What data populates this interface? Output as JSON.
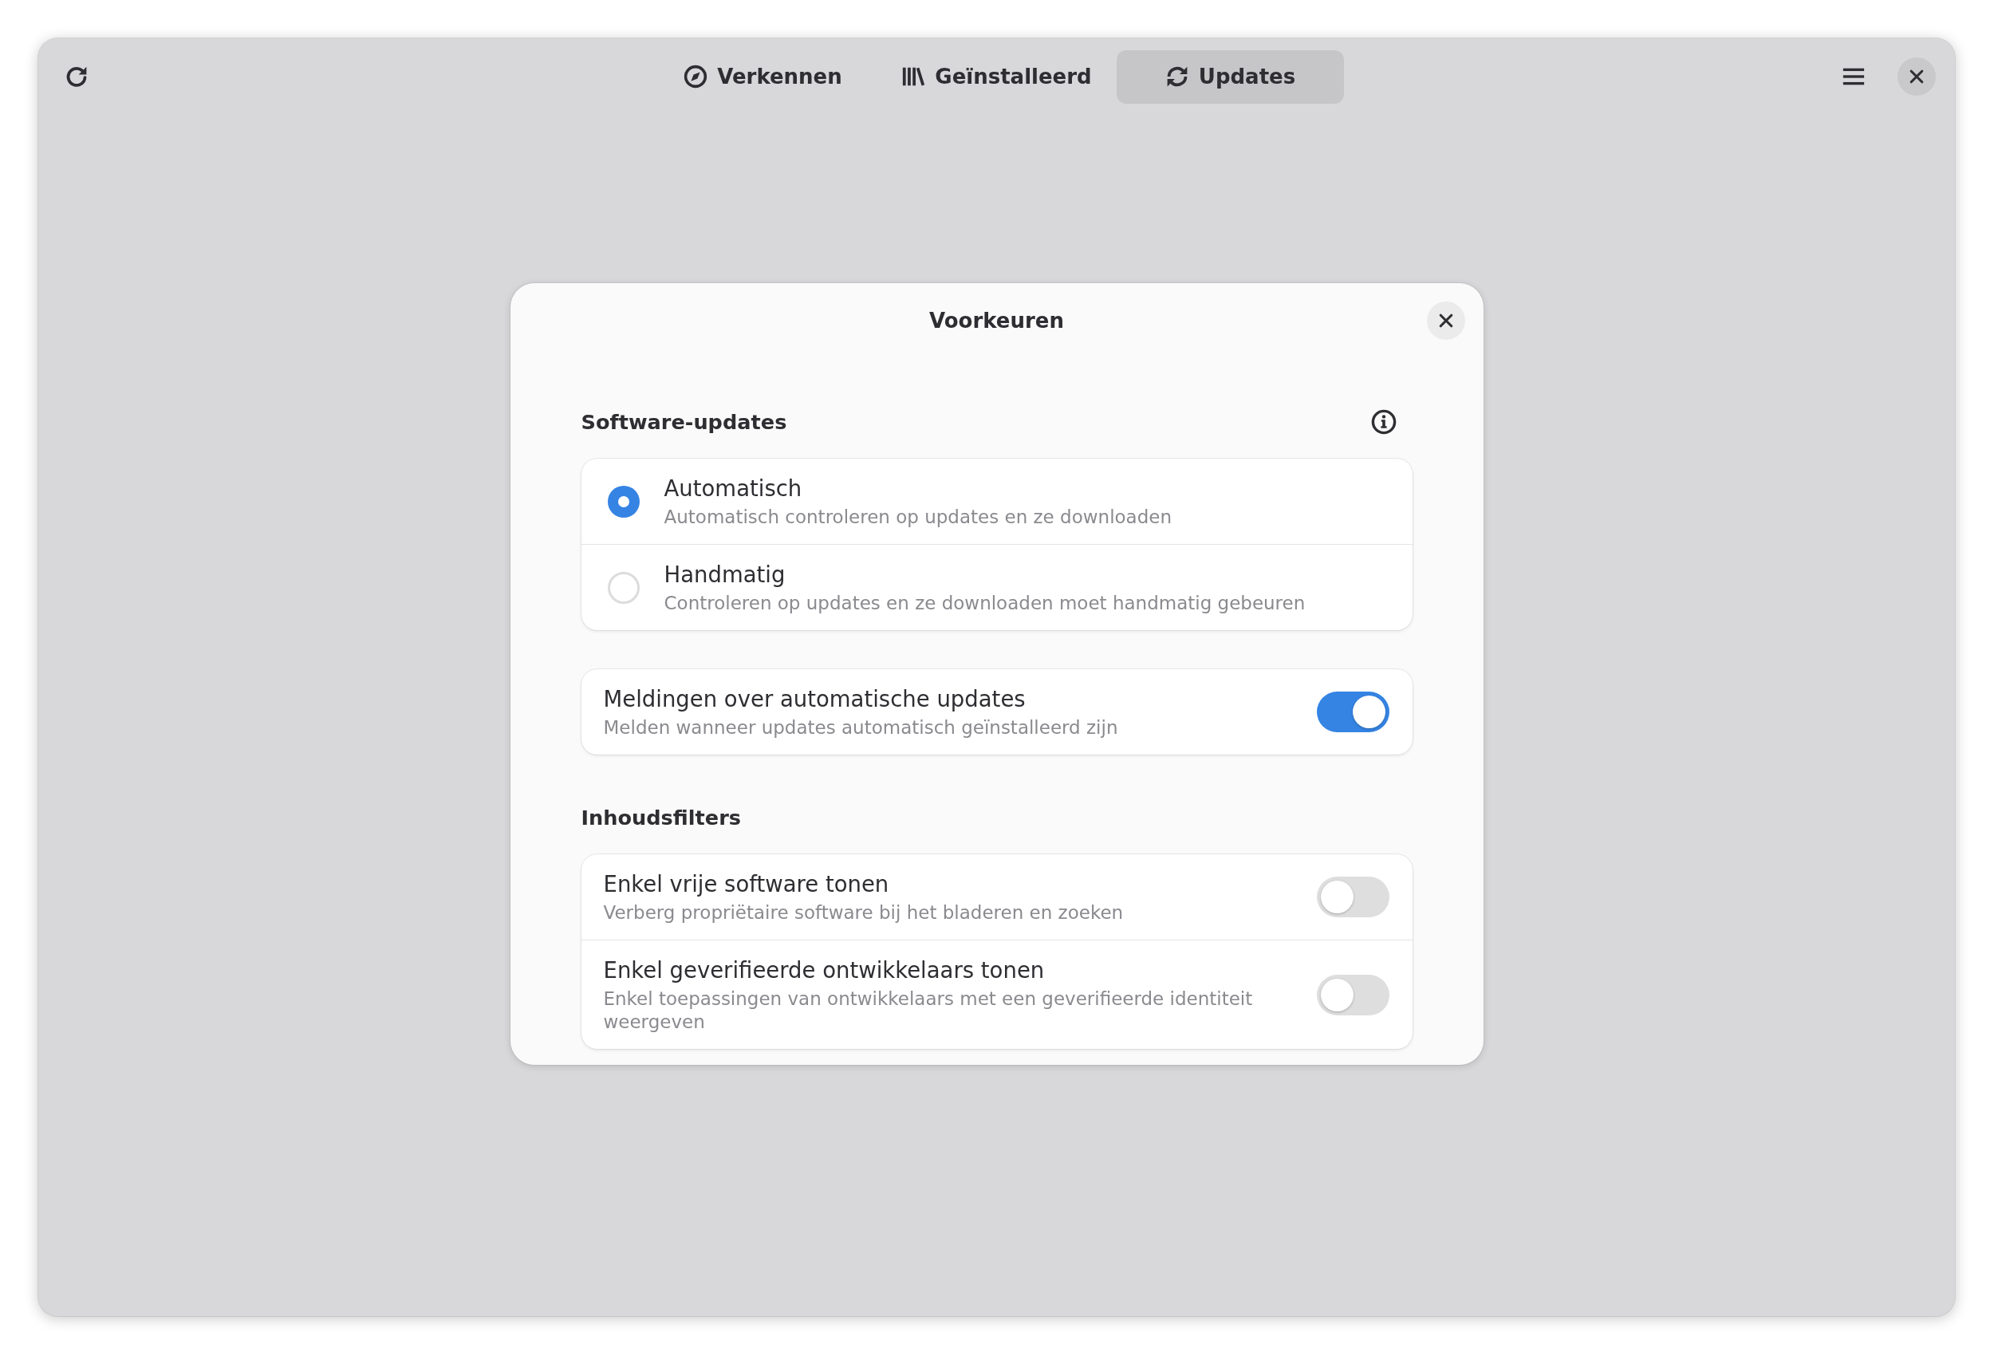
{
  "header_bar": {
    "tabs": [
      {
        "label": "Verkennen",
        "selected": false
      },
      {
        "label": "Geïnstalleerd",
        "selected": false
      },
      {
        "label": "Updates",
        "selected": true
      }
    ]
  },
  "dialog": {
    "title": "Voorkeuren",
    "sections": [
      {
        "heading": "Software-updates",
        "info_button": true,
        "cards": [
          {
            "rows": [
              {
                "kind": "radio",
                "title": "Automatisch",
                "subtitle": "Automatisch controleren op updates en ze downloaden",
                "selected": true
              },
              {
                "kind": "radio",
                "title": "Handmatig",
                "subtitle": "Controleren op updates en ze downloaden moet handmatig gebeuren",
                "selected": false
              }
            ]
          },
          {
            "rows": [
              {
                "kind": "switch",
                "title": "Meldingen over automatische updates",
                "subtitle": "Melden wanneer updates automatisch geïnstalleerd zijn",
                "on": true
              }
            ]
          }
        ]
      },
      {
        "heading": "Inhoudsfilters",
        "cards": [
          {
            "rows": [
              {
                "kind": "switch",
                "title": "Enkel vrije software tonen",
                "subtitle": "Verberg propriëtaire software bij het bladeren en zoeken",
                "on": false
              },
              {
                "kind": "switch",
                "title": "Enkel geverifieerde ontwikkelaars tonen",
                "subtitle": "Enkel toepassingen van ontwikkelaars met een geverifieerde identiteit weergeven",
                "on": false
              }
            ]
          }
        ]
      }
    ]
  }
}
